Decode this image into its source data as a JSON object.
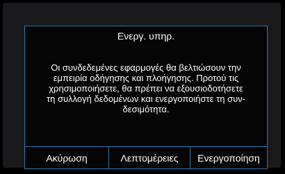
{
  "dialog": {
    "title": "Ενεργ. υπηρ.",
    "message_lines": [
      "Οι συνδεδεμένες εφαρμογές θα βελτιώσουν την",
      "εμπειρία οδήγησης και πλοήγησης. Προτού τις",
      "χρησιμοποιήσετε, θα πρέπει να εξουσιοδοτήσετε",
      "τη συλλογή δεδομένων και ενεργοποιήστε τη συν-",
      "δεσιμότητα."
    ],
    "buttons": {
      "cancel": "Ακύρωση",
      "details": "Λεπτομέρειες",
      "activate": "Ενεργοποίηση"
    }
  },
  "colors": {
    "background": "#000000",
    "dialog_border": "#2f78b5",
    "text": "#ffffff"
  }
}
